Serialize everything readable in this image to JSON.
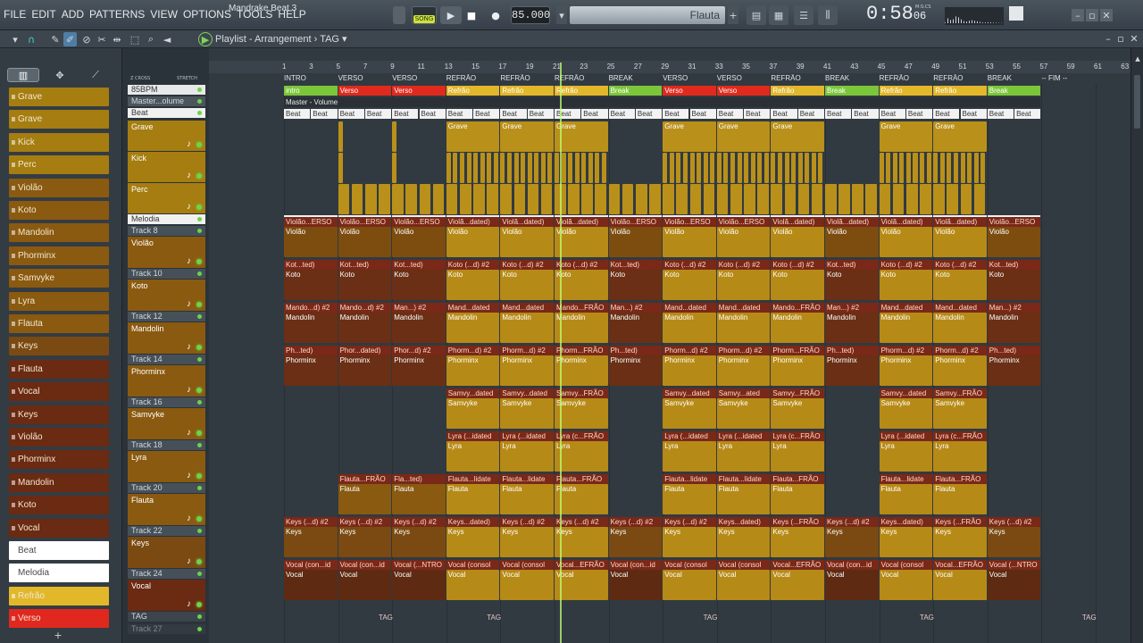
{
  "menu": [
    "FILE",
    "EDIT",
    "ADD",
    "PATTERNS",
    "VIEW",
    "OPTIONS",
    "TOOLS",
    "HELP"
  ],
  "transport": {
    "song_title": "Mandrake Beat 3",
    "mode": "SONG",
    "tempo": "85.000",
    "instrument": "Flauta",
    "time": "0:58",
    "time_sub": "06",
    "time_unit": "M:S:CS"
  },
  "playlist": {
    "title": "Playlist - Arrangement",
    "arrangement": "TAG",
    "cross_label": "Z CROSS",
    "stretch_label": "STRETCH"
  },
  "browser_patterns": [
    {
      "label": "Grave",
      "color": "#a57d10"
    },
    {
      "label": "Grave",
      "color": "#a57d10"
    },
    {
      "label": "Kick",
      "color": "#a57d10"
    },
    {
      "label": "Perc",
      "color": "#a57d10"
    },
    {
      "label": "Violão",
      "color": "#8a5a10"
    },
    {
      "label": "Koto",
      "color": "#8a5a10"
    },
    {
      "label": "Mandolin",
      "color": "#8a5a10"
    },
    {
      "label": "Phorminx",
      "color": "#8a5a10"
    },
    {
      "label": "Samvyke",
      "color": "#8a5a10"
    },
    {
      "label": "Lyra",
      "color": "#8a5a10"
    },
    {
      "label": "Flauta",
      "color": "#8a5a10"
    },
    {
      "label": "Keys",
      "color": "#7a4a12"
    },
    {
      "label": "Flauta",
      "color": "#6b2a12"
    },
    {
      "label": "Vocal",
      "color": "#6b2a12"
    },
    {
      "label": "Keys",
      "color": "#6b2a12"
    },
    {
      "label": "Violão",
      "color": "#6b2a12"
    },
    {
      "label": "Phorminx",
      "color": "#6b2a12"
    },
    {
      "label": "Mandolin",
      "color": "#6b2a12"
    },
    {
      "label": "Koto",
      "color": "#6b2a12"
    },
    {
      "label": "Vocal",
      "color": "#6b2a12"
    },
    {
      "label": "Beat",
      "color": "#ffffff"
    },
    {
      "label": "Melodia",
      "color": "#ffffff"
    },
    {
      "label": "Refrão",
      "color": "#e2b72a"
    },
    {
      "label": "Verso",
      "color": "#e0281e"
    }
  ],
  "tracks": {
    "header_tempo": "85BPM",
    "master": "Master...olume",
    "beat": "Beat",
    "grave": "Grave",
    "kick": "Kick",
    "perc": "Perc",
    "melodia": "Melodia",
    "t8": "Track 8",
    "violao": "Violão",
    "t10": "Track 10",
    "koto": "Koto",
    "t12": "Track 12",
    "mandolin": "Mandolin",
    "t14": "Track 14",
    "phorminx": "Phorminx",
    "t16": "Track 16",
    "samvyke": "Samvyke",
    "t18": "Track 18",
    "lyra": "Lyra",
    "t20": "Track 20",
    "flauta": "Flauta",
    "t22": "Track 22",
    "keys": "Keys",
    "t24": "Track 24",
    "vocal": "Vocal",
    "tag": "TAG",
    "t27": "Track 27"
  },
  "ruler": [
    "1",
    "3",
    "5",
    "7",
    "9",
    "11",
    "13",
    "15",
    "17",
    "19",
    "21",
    "23",
    "25",
    "27",
    "29",
    "31",
    "33",
    "35",
    "37",
    "39",
    "41",
    "43",
    "45",
    "47",
    "49",
    "51",
    "53",
    "55",
    "57",
    "59",
    "61",
    "63"
  ],
  "markers": [
    "INTRO",
    "VERSO",
    "VERSO",
    "REFRÃO",
    "REFRÃO",
    "REFRÃO",
    "BREAK",
    "VERSO",
    "VERSO",
    "REFRÃO",
    "BREAK",
    "REFRÃO",
    "REFRÃO",
    "BREAK",
    "-- FIM --"
  ],
  "sections": [
    {
      "label": "intro",
      "color": "#7cc63a"
    },
    {
      "label": "Verso",
      "color": "#e02a1e"
    },
    {
      "label": "Verso",
      "color": "#e02a1e"
    },
    {
      "label": "Refrão",
      "color": "#e2b72a"
    },
    {
      "label": "Refrão",
      "color": "#e2b72a"
    },
    {
      "label": "Refrão",
      "color": "#e2b72a"
    },
    {
      "label": "Break",
      "color": "#7cc63a"
    },
    {
      "label": "Verso",
      "color": "#e02a1e"
    },
    {
      "label": "Verso",
      "color": "#e02a1e"
    },
    {
      "label": "Refrão",
      "color": "#e2b72a"
    },
    {
      "label": "Break",
      "color": "#7cc63a"
    },
    {
      "label": "Refrão",
      "color": "#e2b72a"
    },
    {
      "label": "Refrão",
      "color": "#e2b72a"
    },
    {
      "label": "Break",
      "color": "#7cc63a"
    }
  ],
  "master_volume": "Master - Volume",
  "clip_labels": {
    "beat": "Beat",
    "melodia": "Melodia",
    "violao": "Violão",
    "koto": "Koto",
    "mandolin": "Mandolin",
    "phorminx": "Phorminx",
    "samvyke": "Samvyke",
    "lyra": "Lyra",
    "flauta": "Flauta",
    "keys": "Keys",
    "vocal": "Vocal",
    "grave": "Grave",
    "tag": "TAG"
  },
  "auto_labels": {
    "violao": [
      "Violão...ERSO",
      "Violão...ERSO",
      "Violão...ERSO",
      "Violã...dated)",
      "Violã...dated)",
      "Violã...dated)",
      "Violão...ERSO",
      "Violão...ERSO",
      "Violão...ERSO",
      "Violã...dated)",
      "Violã...dated)",
      "Violã...dated)",
      "Violã...dated)",
      "Violão...ERSO"
    ],
    "koto": [
      "Kot...ted)",
      "Kot...ted)",
      "Kot...ted)",
      "Koto (...d) #2",
      "Koto (...d) #2",
      "Koto (...d) #2",
      "Kot...ted)",
      "Koto (...d) #2",
      "Koto (...d) #2",
      "Koto (...d) #2",
      "Kot...ted)",
      "Koto (...d) #2",
      "Koto (...d) #2",
      "Kot...ted)"
    ],
    "mandolin": [
      "Mando...d) #2",
      "Mando...d) #2",
      "Man...) #2",
      "Mand...dated",
      "Mand...dated",
      "Mando...FRÃO",
      "Man...) #2",
      "Mand...dated",
      "Mand...dated",
      "Mando...FRÃO",
      "Man...) #2",
      "Mand...dated",
      "Mand...dated",
      "Man...) #2"
    ],
    "phorminx": [
      "Ph...ted)",
      "Phor...dated)",
      "Phor...d) #2",
      "Phorm...d) #2",
      "Phorm...d) #2",
      "Phorm...FRÃO",
      "Ph...ted)",
      "Phorm...d) #2",
      "Phorm...d) #2",
      "Phorm...FRÃO",
      "Ph...ted)",
      "Phorm...d) #2",
      "Phorm...d) #2",
      "Ph...ted)"
    ],
    "samvyke": [
      "Samvy...dated",
      "Samvy...dated",
      "Samvy...FRÃO",
      "Samvy...dated",
      "Samvy...ated",
      "Samvy...FRÃO",
      "Samvy...dated",
      "Samvy...FRÃO"
    ],
    "lyra": [
      "Lyra (...idated",
      "Lyra (...idated",
      "Lyra (c...FRÃO",
      "Lyra (...idated",
      "Lyra (...idated",
      "Lyra (c...FRÃO",
      "Lyra (...idated",
      "Lyra (c...FRÃO"
    ],
    "flauta": [
      "Flauta...FRÃO",
      "Fla...ted)",
      "Flauta...lidate",
      "Flauta...lidate",
      "Flauta...FRÃO",
      "Flauta...lidate",
      "Flauta...lidate",
      "Flauta...FRÃO",
      "Flauta...lidate",
      "Flauta...FRÃO"
    ],
    "keys": [
      "Keys (...d) #2",
      "Keys (...d) #2",
      "Keys (...d) #2",
      "Keys...dated)",
      "Keys (...d) #2",
      "Keys (...d) #2",
      "Keys (...d) #2",
      "Keys (...d) #2",
      "Keys...dated)",
      "Keys (...FRÃO",
      "Keys (...d) #2",
      "Keys...dated)",
      "Keys (...FRÃO",
      "Keys (...d) #2"
    ],
    "vocal": [
      "Vocal (con...id",
      "Vocal (con...id",
      "Vocal (...NTRO",
      "Vocal (consol",
      "Vocal (consol",
      "Vocal...EFRÃO",
      "Vocal (con...id",
      "Vocal (consol",
      "Vocal (consol",
      "Vocal...EFRÃO",
      "Vocal (con...id",
      "Vocal (consol",
      "Vocal...EFRÃO",
      "Vocal (...NTRO"
    ]
  }
}
